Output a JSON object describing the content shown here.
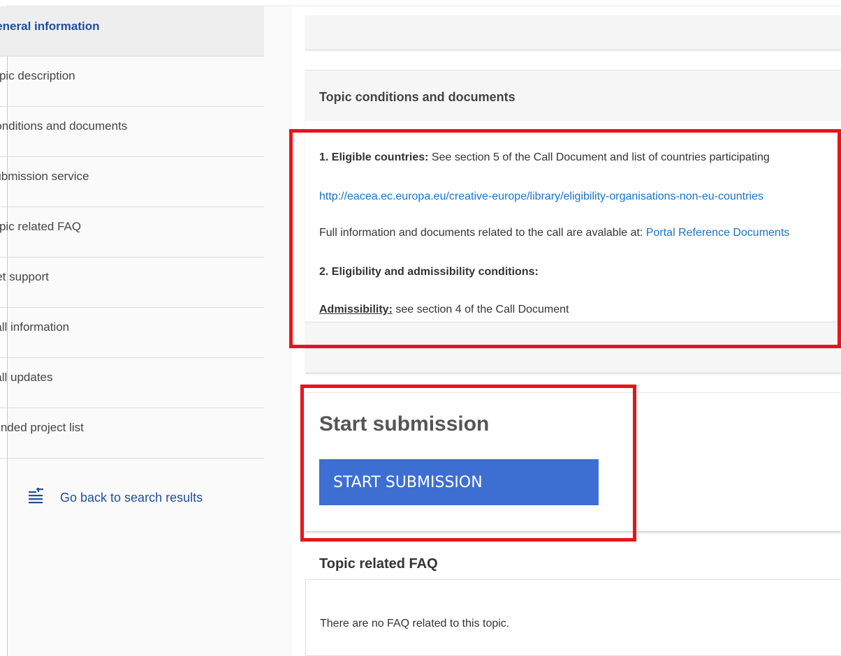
{
  "sidebar": {
    "items": [
      {
        "label": "General information",
        "active": true
      },
      {
        "label": "Topic description"
      },
      {
        "label": "Conditions and documents"
      },
      {
        "label": "Submission service"
      },
      {
        "label": "Topic related FAQ"
      },
      {
        "label": "Get support"
      },
      {
        "label": "Call information"
      },
      {
        "label": "Call updates"
      },
      {
        "label": "Funded project list"
      }
    ],
    "go_back": {
      "label": "Go back to search results",
      "icon": "back-to-list-icon"
    }
  },
  "topic_conditions": {
    "header": "Topic conditions and documents",
    "line1_bold": "1. Eligible countries:",
    "line1_text": " See section 5 of the Call Document  and list of countries participating",
    "link_url": "http://eacea.ec.europa.eu/creative-europe/library/eligibility-organisations-non-eu-countries",
    "line3_text": "Full information and documents related to the call are avalable at: ",
    "line3_link": "Portal Reference Documents",
    "line4_bold": "2. Eligibility and admissibility conditions:",
    "line5_bold": "Admissibility:",
    "line5_text": " see section 4 of the Call Document"
  },
  "start_submission": {
    "title": "Start submission",
    "button_label": "START SUBMISSION"
  },
  "faq": {
    "title": "Topic related FAQ",
    "empty_text": "There are no FAQ related to this topic."
  },
  "colors": {
    "accent": "#1f4e9b",
    "button": "#3d6fd2",
    "link": "#1a73c7",
    "annotation": "#e8141c"
  }
}
